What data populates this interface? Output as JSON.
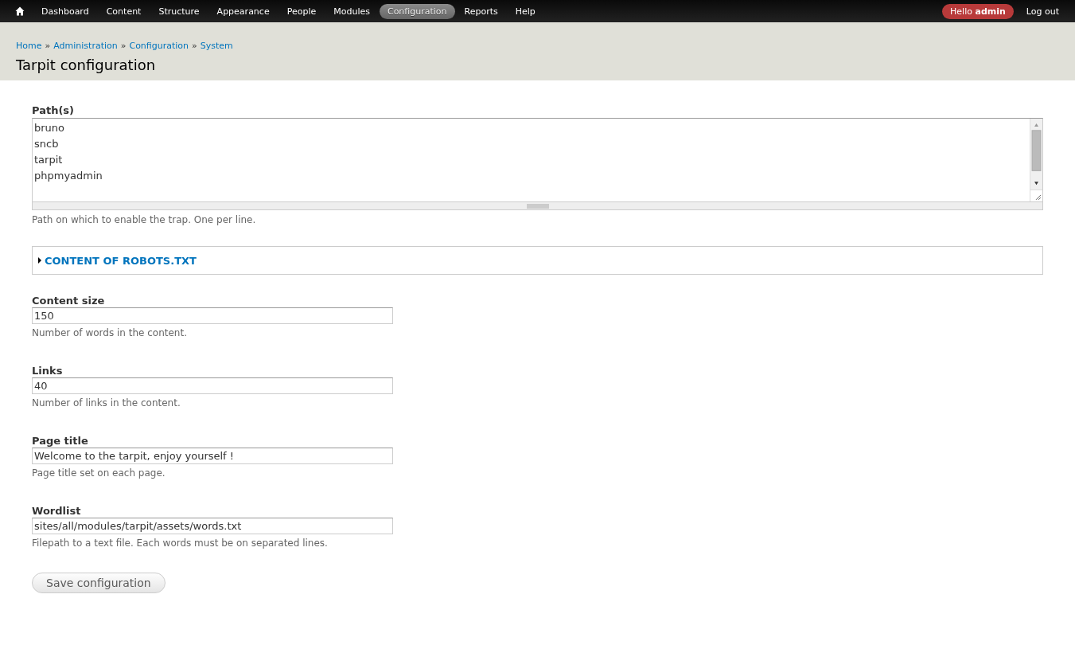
{
  "toolbar": {
    "menu": [
      {
        "label": "Dashboard",
        "selected": false
      },
      {
        "label": "Content",
        "selected": false
      },
      {
        "label": "Structure",
        "selected": false
      },
      {
        "label": "Appearance",
        "selected": false
      },
      {
        "label": "People",
        "selected": false
      },
      {
        "label": "Modules",
        "selected": false
      },
      {
        "label": "Configuration",
        "selected": true
      },
      {
        "label": "Reports",
        "selected": false
      },
      {
        "label": "Help",
        "selected": false
      }
    ],
    "greeting": "Hello **admin**",
    "logout": "Log out"
  },
  "breadcrumb": [
    "Home",
    "Administration",
    "Configuration",
    "System"
  ],
  "breadcrumb_separator": "»",
  "page_title": "Tarpit configuration",
  "paths_field": {
    "label": "Path(s)",
    "lines": [
      "bruno",
      "sncb",
      "tarpit",
      "phpmyadmin"
    ],
    "description": "Path on which to enable the trap. One per line."
  },
  "robots_fieldset": {
    "legend": "CONTENT OF ROBOTS.TXT",
    "collapsed": true
  },
  "fields": [
    {
      "label": "Content size",
      "value": "150",
      "description": "Number of words in the content."
    },
    {
      "label": "Links",
      "value": "40",
      "description": "Number of links in the content."
    },
    {
      "label": "Page title",
      "value": "Welcome to the tarpit, enjoy yourself !",
      "description": "Page title set on each page."
    },
    {
      "label": "Wordlist",
      "value": "sites/all/modules/tarpit/assets/words.txt",
      "description": "Filepath to a text file. Each words must be on separated lines."
    }
  ],
  "save_button": "Save configuration"
}
